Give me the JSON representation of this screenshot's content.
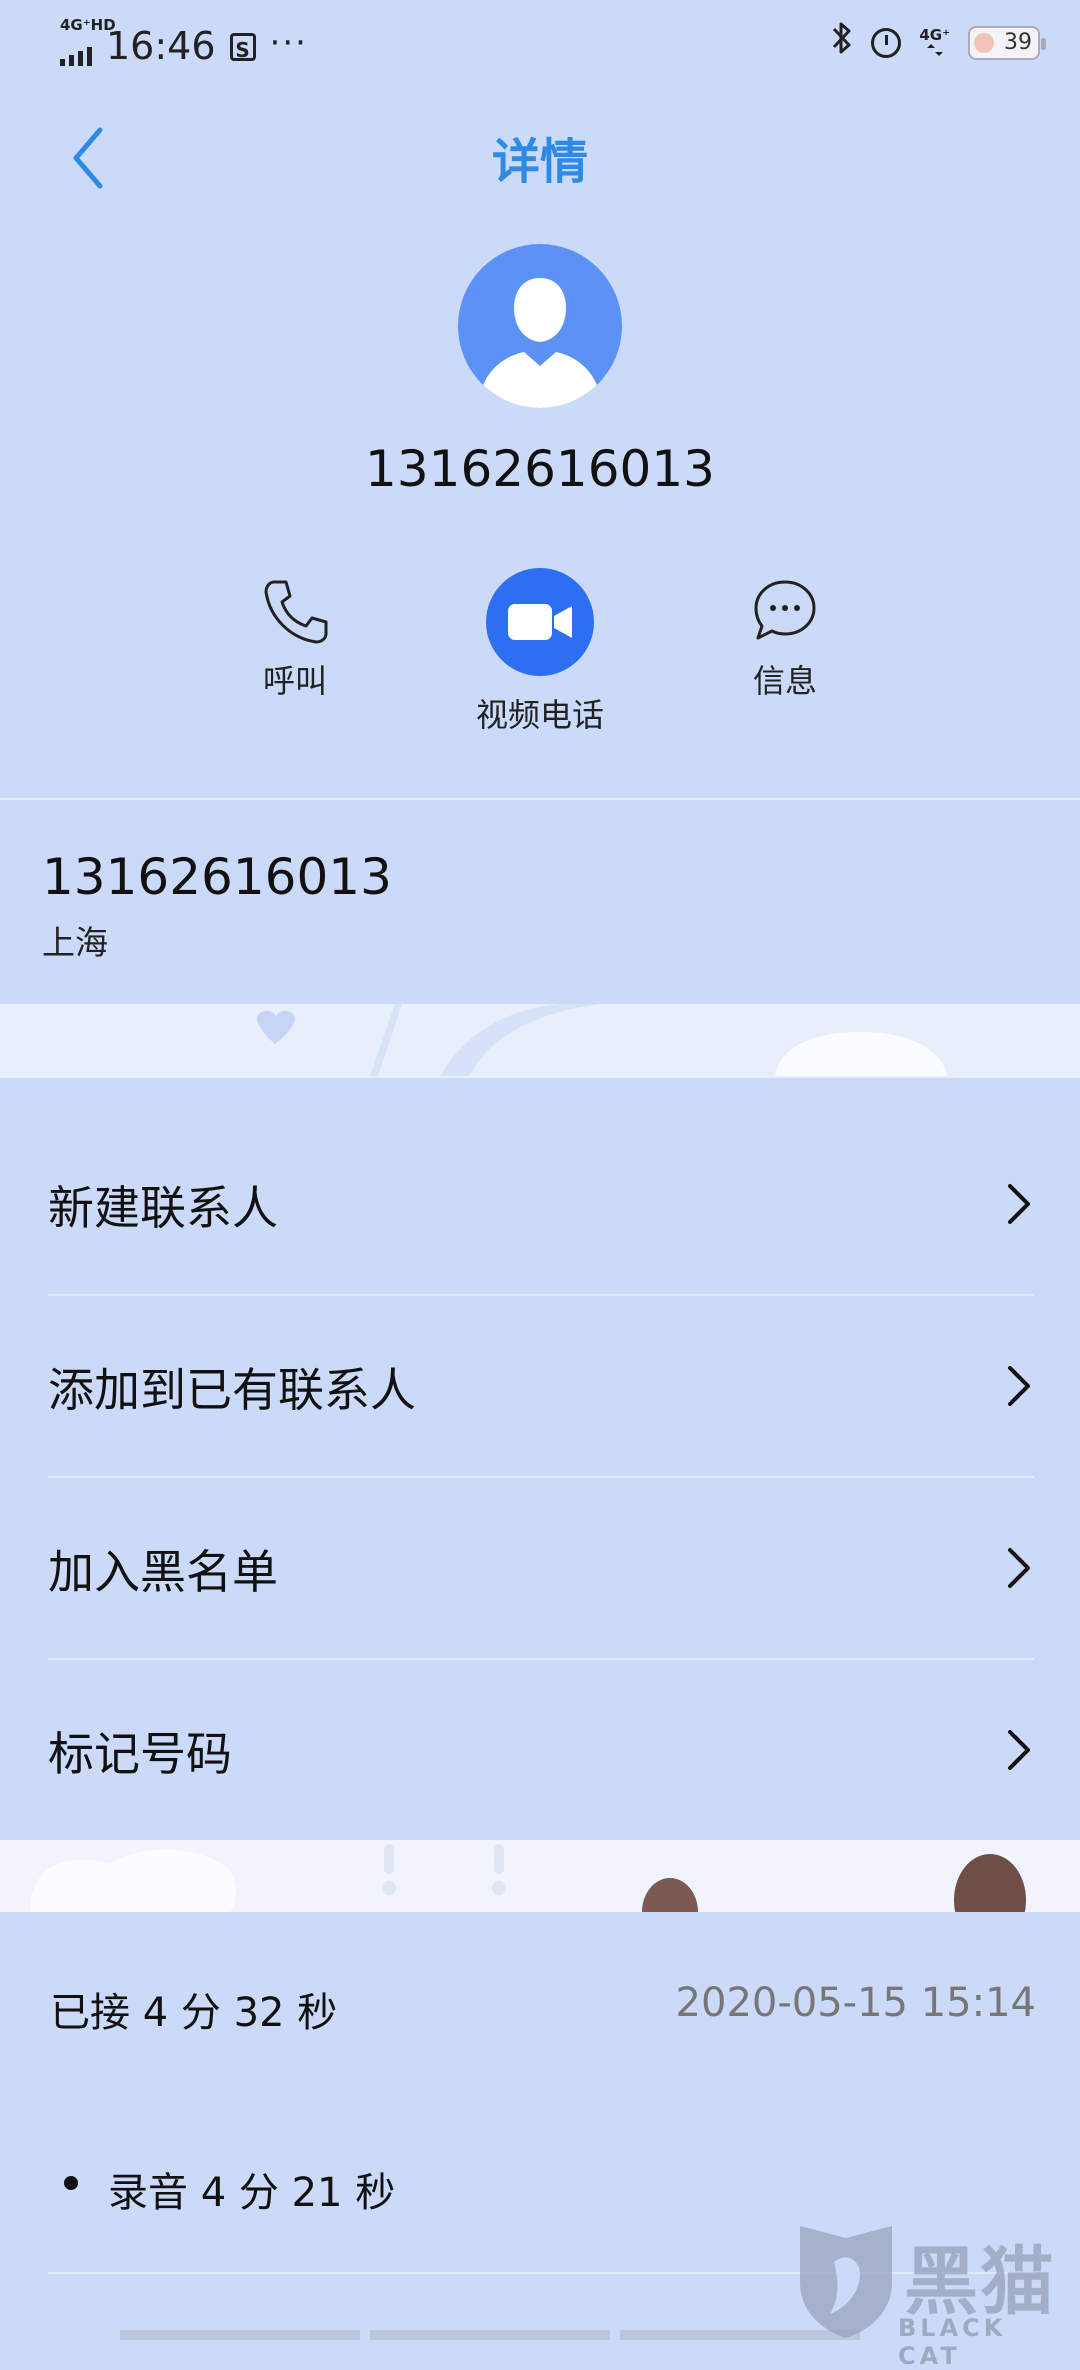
{
  "status_bar": {
    "network_left": "4G⁺HD",
    "time": "16:46",
    "extra_icon": "S",
    "more": "···",
    "network_right": "4G⁺",
    "battery": "39",
    "icons": [
      "signal-icon",
      "bluetooth-icon",
      "alarm-icon",
      "battery-icon"
    ]
  },
  "header": {
    "title": "详情"
  },
  "contact": {
    "number": "13162616013",
    "location": "上海"
  },
  "actions": {
    "call_label": "呼叫",
    "video_label": "视频电话",
    "message_label": "信息"
  },
  "menu": [
    {
      "label": "新建联系人"
    },
    {
      "label": "添加到已有联系人"
    },
    {
      "label": "加入黑名单"
    },
    {
      "label": "标记号码"
    }
  ],
  "history": {
    "status": "已接 4 分 32 秒",
    "datetime": "2020-05-15 15:14",
    "recording": "录音 4 分 21 秒"
  },
  "watermark": {
    "cn": "黑猫",
    "en": "BLACK CAT"
  },
  "colors": {
    "background": "#cbdaf8",
    "accent": "#2f8ae6",
    "avatar": "#5b92f4",
    "video_button": "#2e6ef0"
  }
}
